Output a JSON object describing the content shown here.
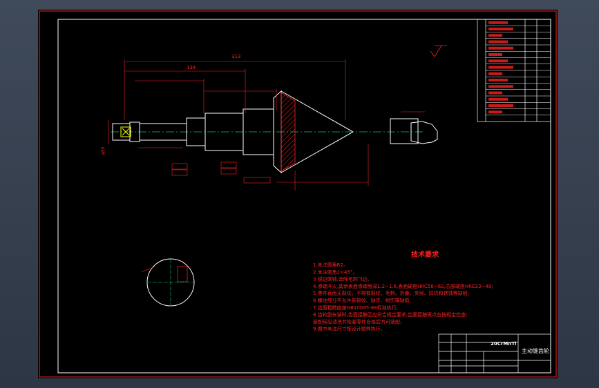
{
  "drawing": {
    "material": "20CrMnTi",
    "part_name": "主动锥齿轮",
    "tech_title": "技术要求",
    "tech_lines": [
      "1.未注圆角R2。",
      "2.未注倒角2×45°。",
      "3.锐边倒钝,去除毛刺飞边。",
      "4.渗碳淬火,其余表面渗碳层深1.2~1.6,表面硬度HRC58~62,芯部硬度HRC33~48;",
      "5.零件表面无裂纹、不得有裂纹、毛刺、折叠、夹层、凹坑和锈蚀等缺陷;",
      "6.螺纹部分不允许有裂纹、缺牙、损伤等缺陷;",
      "7.齿面粗糙度按GB10095-88标准执行;",
      "8.齿轮副安装时,齿面接触区应符合规定要求,齿面接触斑点应按规定检查;",
      "   装配前应清洗并检查零件合格后方可装配;",
      "9.图中未注尺寸按设计图样执行。"
    ],
    "dims": {
      "overall_length": "313",
      "left_dim": "134",
      "small_d": "φ55"
    }
  }
}
